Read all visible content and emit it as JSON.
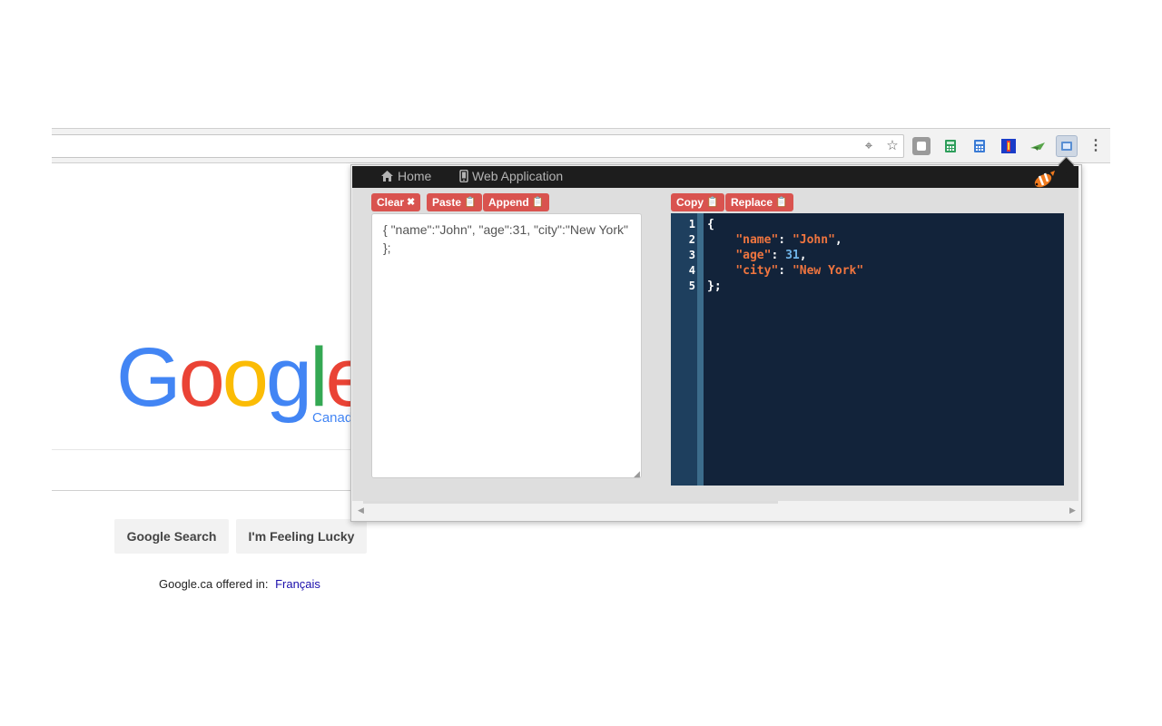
{
  "browser": {
    "toolbar_icons": [
      "location-target-icon",
      "star-icon"
    ],
    "extensions": [
      {
        "name": "tab-extension-icon",
        "color": "#8a8a8a"
      },
      {
        "name": "calculator-green-icon",
        "color": "#2e9e5b"
      },
      {
        "name": "calculator-blue-icon",
        "color": "#3a7bd5"
      },
      {
        "name": "colorful-extension-icon",
        "color": "#1a3cc8"
      },
      {
        "name": "plane-extension-icon",
        "color": "#57a54a"
      },
      {
        "name": "json-extension-icon",
        "color": "#5a8fd3"
      }
    ]
  },
  "google": {
    "logo_letters": [
      "G",
      "o",
      "o",
      "g",
      "l",
      "e"
    ],
    "logo_colors": [
      "#4285F4",
      "#EA4335",
      "#FBBC05",
      "#4285F4",
      "#34A853",
      "#EA4335"
    ],
    "region": "Canad",
    "search_button": "Google Search",
    "lucky_button": "I'm Feeling Lucky",
    "offered_text": "Google.ca offered in:",
    "offered_language": "Français"
  },
  "popup": {
    "nav": {
      "home": "Home",
      "web_app": "Web Application"
    },
    "left_buttons": {
      "clear": "Clear",
      "paste": "Paste",
      "append": "Append"
    },
    "right_buttons": {
      "copy": "Copy",
      "replace": "Replace"
    },
    "input_text": "{ \"name\":\"John\", \"age\":31, \"city\":\"New York\" };",
    "editor": {
      "line_numbers": [
        "1",
        "2",
        "3",
        "4",
        "5"
      ],
      "lines": [
        {
          "text": "{"
        },
        {
          "key": "\"name\"",
          "sep": ": ",
          "value": "\"John\"",
          "end": ","
        },
        {
          "key": "\"age\"",
          "sep": ": ",
          "value": "31",
          "end": ","
        },
        {
          "key": "\"city\"",
          "sep": ": ",
          "value": "\"New York\"",
          "end": ""
        },
        {
          "text": "};"
        }
      ]
    },
    "colors": {
      "accent_button": "#d9534f",
      "editor_bg": "#12233a",
      "key_color": "#f0753f",
      "number_color": "#6fb4e8"
    }
  }
}
